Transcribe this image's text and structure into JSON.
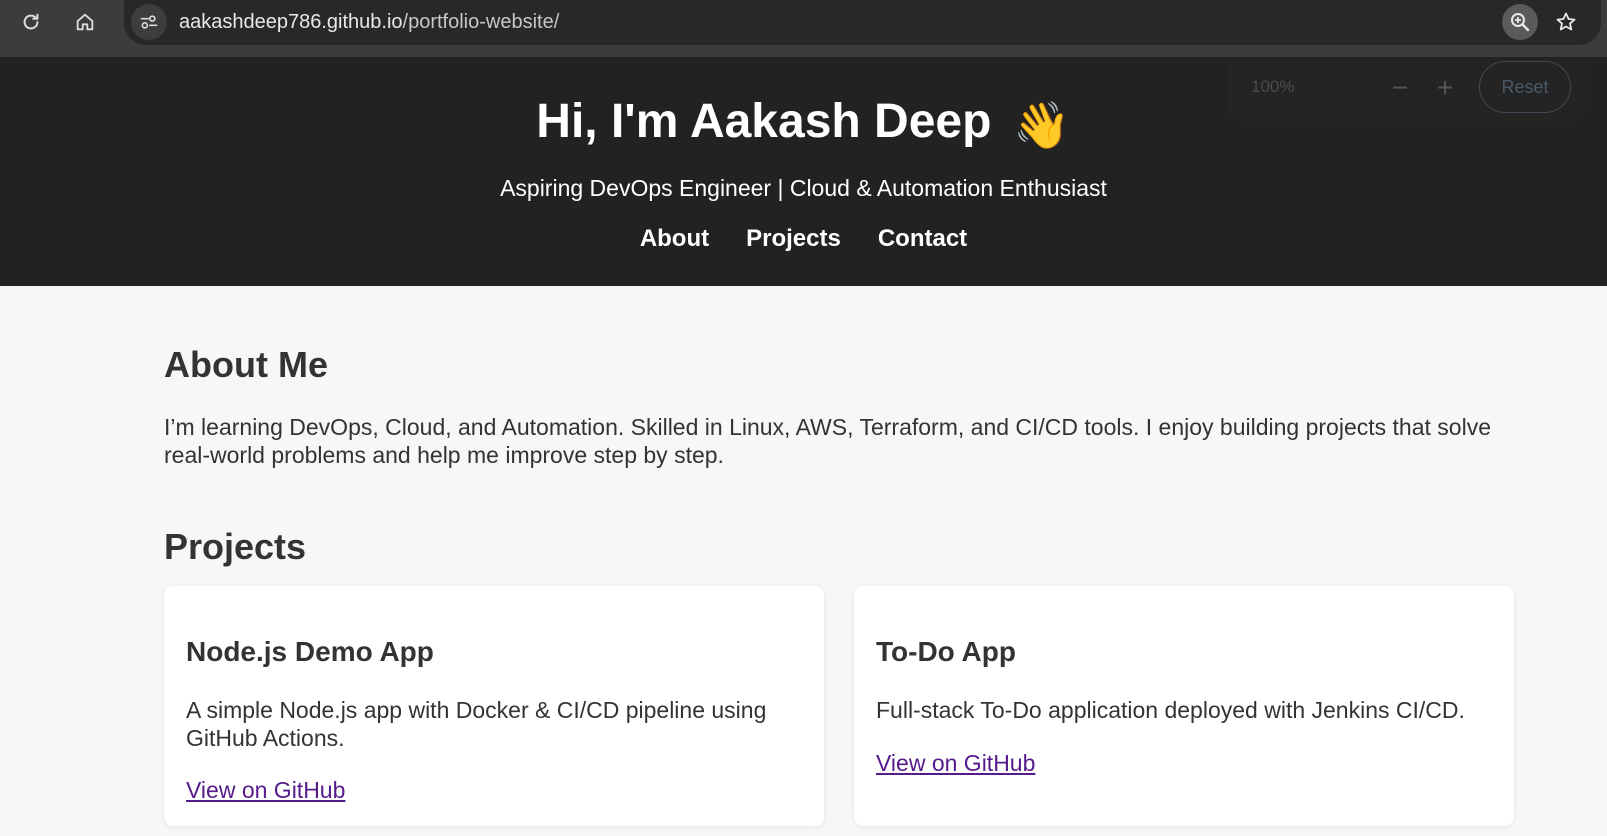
{
  "browser": {
    "url_host": "aakashdeep786.github.io",
    "url_path": "/portfolio-website/",
    "zoom_popup": {
      "level": "100%",
      "minus": "−",
      "plus": "+",
      "reset_label": "Reset"
    },
    "icons": [
      "reload-icon",
      "home-icon",
      "site-info-icon",
      "zoom-icon",
      "bookmark-star-icon"
    ]
  },
  "header": {
    "title": "Hi, I'm Aakash Deep",
    "title_emoji": "👋",
    "tagline": "Aspiring DevOps Engineer | Cloud & Automation Enthusiast",
    "nav": [
      {
        "label": "About"
      },
      {
        "label": "Projects"
      },
      {
        "label": "Contact"
      }
    ]
  },
  "about": {
    "heading": "About Me",
    "text": "I’m learning DevOps, Cloud, and Automation. Skilled in Linux, AWS, Terraform, and CI/CD tools. I enjoy building projects that solve real-world problems and help me improve step by step."
  },
  "projects": {
    "heading": "Projects",
    "items": [
      {
        "title": "Node.js Demo App",
        "description": "A simple Node.js app with Docker & CI/CD pipeline using GitHub Actions.",
        "link_label": "View on GitHub"
      },
      {
        "title": "To-Do App",
        "description": "Full-stack To-Do application deployed with Jenkins CI/CD.",
        "link_label": "View on GitHub"
      }
    ]
  },
  "colors": {
    "header_bg": "#222222",
    "page_bg": "#f7f7f7",
    "link_visited": "#551a8b"
  }
}
